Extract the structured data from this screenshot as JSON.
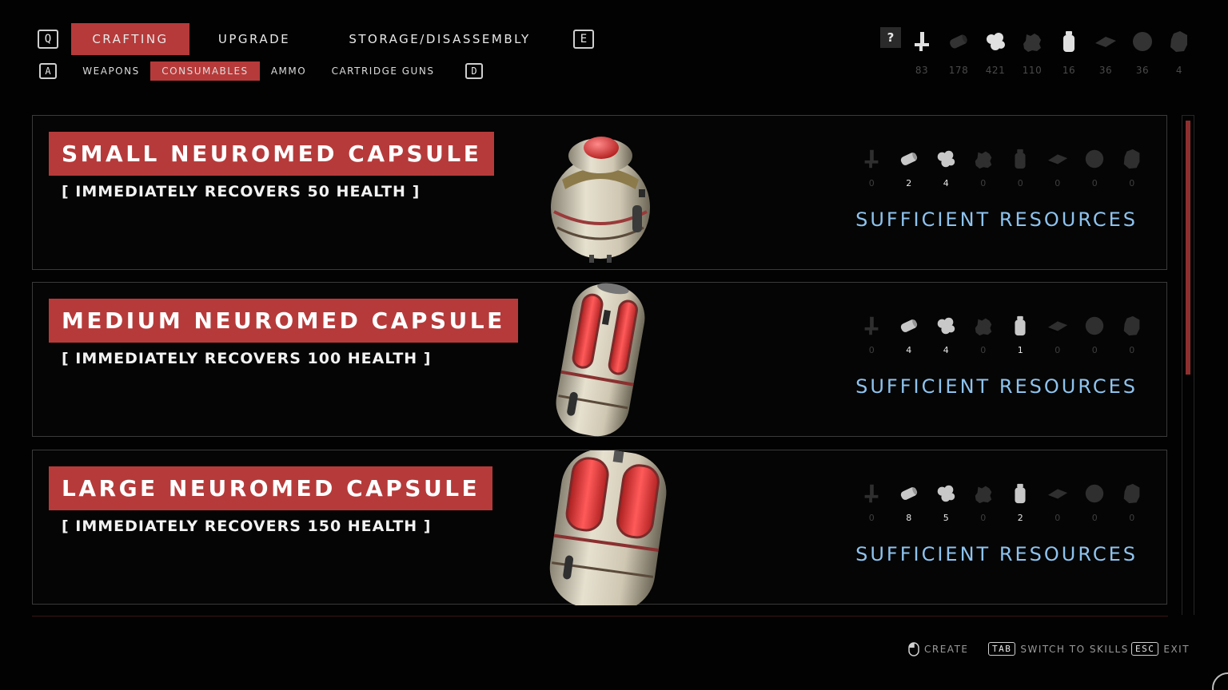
{
  "header": {
    "key_prev": "Q",
    "key_next": "E",
    "tabs": [
      {
        "label": "CRAFTING",
        "active": true
      },
      {
        "label": "UPGRADE",
        "active": false
      },
      {
        "label": "STORAGE/DISASSEMBLY",
        "active": false
      }
    ],
    "subkey_prev": "A",
    "subkey_next": "D",
    "subtabs": [
      {
        "label": "WEAPONS",
        "active": false
      },
      {
        "label": "CONSUMABLES",
        "active": true
      },
      {
        "label": "AMMO",
        "active": false
      },
      {
        "label": "CARTRIDGE GUNS",
        "active": false
      }
    ]
  },
  "help_label": "?",
  "resources": [
    {
      "icon": "bolt-icon",
      "count": "83",
      "lit": true
    },
    {
      "icon": "cylinder-icon",
      "count": "178",
      "lit": false
    },
    {
      "icon": "cluster-icon",
      "count": "421",
      "lit": true
    },
    {
      "icon": "gear-lump-icon",
      "count": "110",
      "lit": false
    },
    {
      "icon": "bottle-icon",
      "count": "16",
      "lit": true
    },
    {
      "icon": "plate-icon",
      "count": "36",
      "lit": false
    },
    {
      "icon": "sphere-icon",
      "count": "36",
      "lit": false
    },
    {
      "icon": "crystal-icon",
      "count": "4",
      "lit": false
    }
  ],
  "recipes": [
    {
      "title": "SMALL NEUROMED CAPSULE",
      "description": "[ IMMEDIATELY RECOVERS 50 HEALTH ]",
      "costs": [
        "0",
        "2",
        "4",
        "0",
        "0",
        "0",
        "0",
        "0"
      ],
      "status": "SUFFICIENT RESOURCES"
    },
    {
      "title": "MEDIUM NEUROMED CAPSULE",
      "description": "[ IMMEDIATELY RECOVERS 100 HEALTH ]",
      "costs": [
        "0",
        "4",
        "4",
        "0",
        "1",
        "0",
        "0",
        "0"
      ],
      "status": "SUFFICIENT RESOURCES"
    },
    {
      "title": "LARGE NEUROMED CAPSULE",
      "description": "[ IMMEDIATELY RECOVERS 150 HEALTH ]",
      "costs": [
        "0",
        "8",
        "5",
        "0",
        "2",
        "0",
        "0",
        "0"
      ],
      "status": "SUFFICIENT RESOURCES"
    }
  ],
  "footer": {
    "create_label": "CREATE",
    "tab_key": "TAB",
    "switch_label": "SWITCH TO SKILLS",
    "esc_key": "ESC",
    "exit_label": "EXIT"
  },
  "colors": {
    "accent": "#b63a3a",
    "status": "#8ec3ee"
  }
}
